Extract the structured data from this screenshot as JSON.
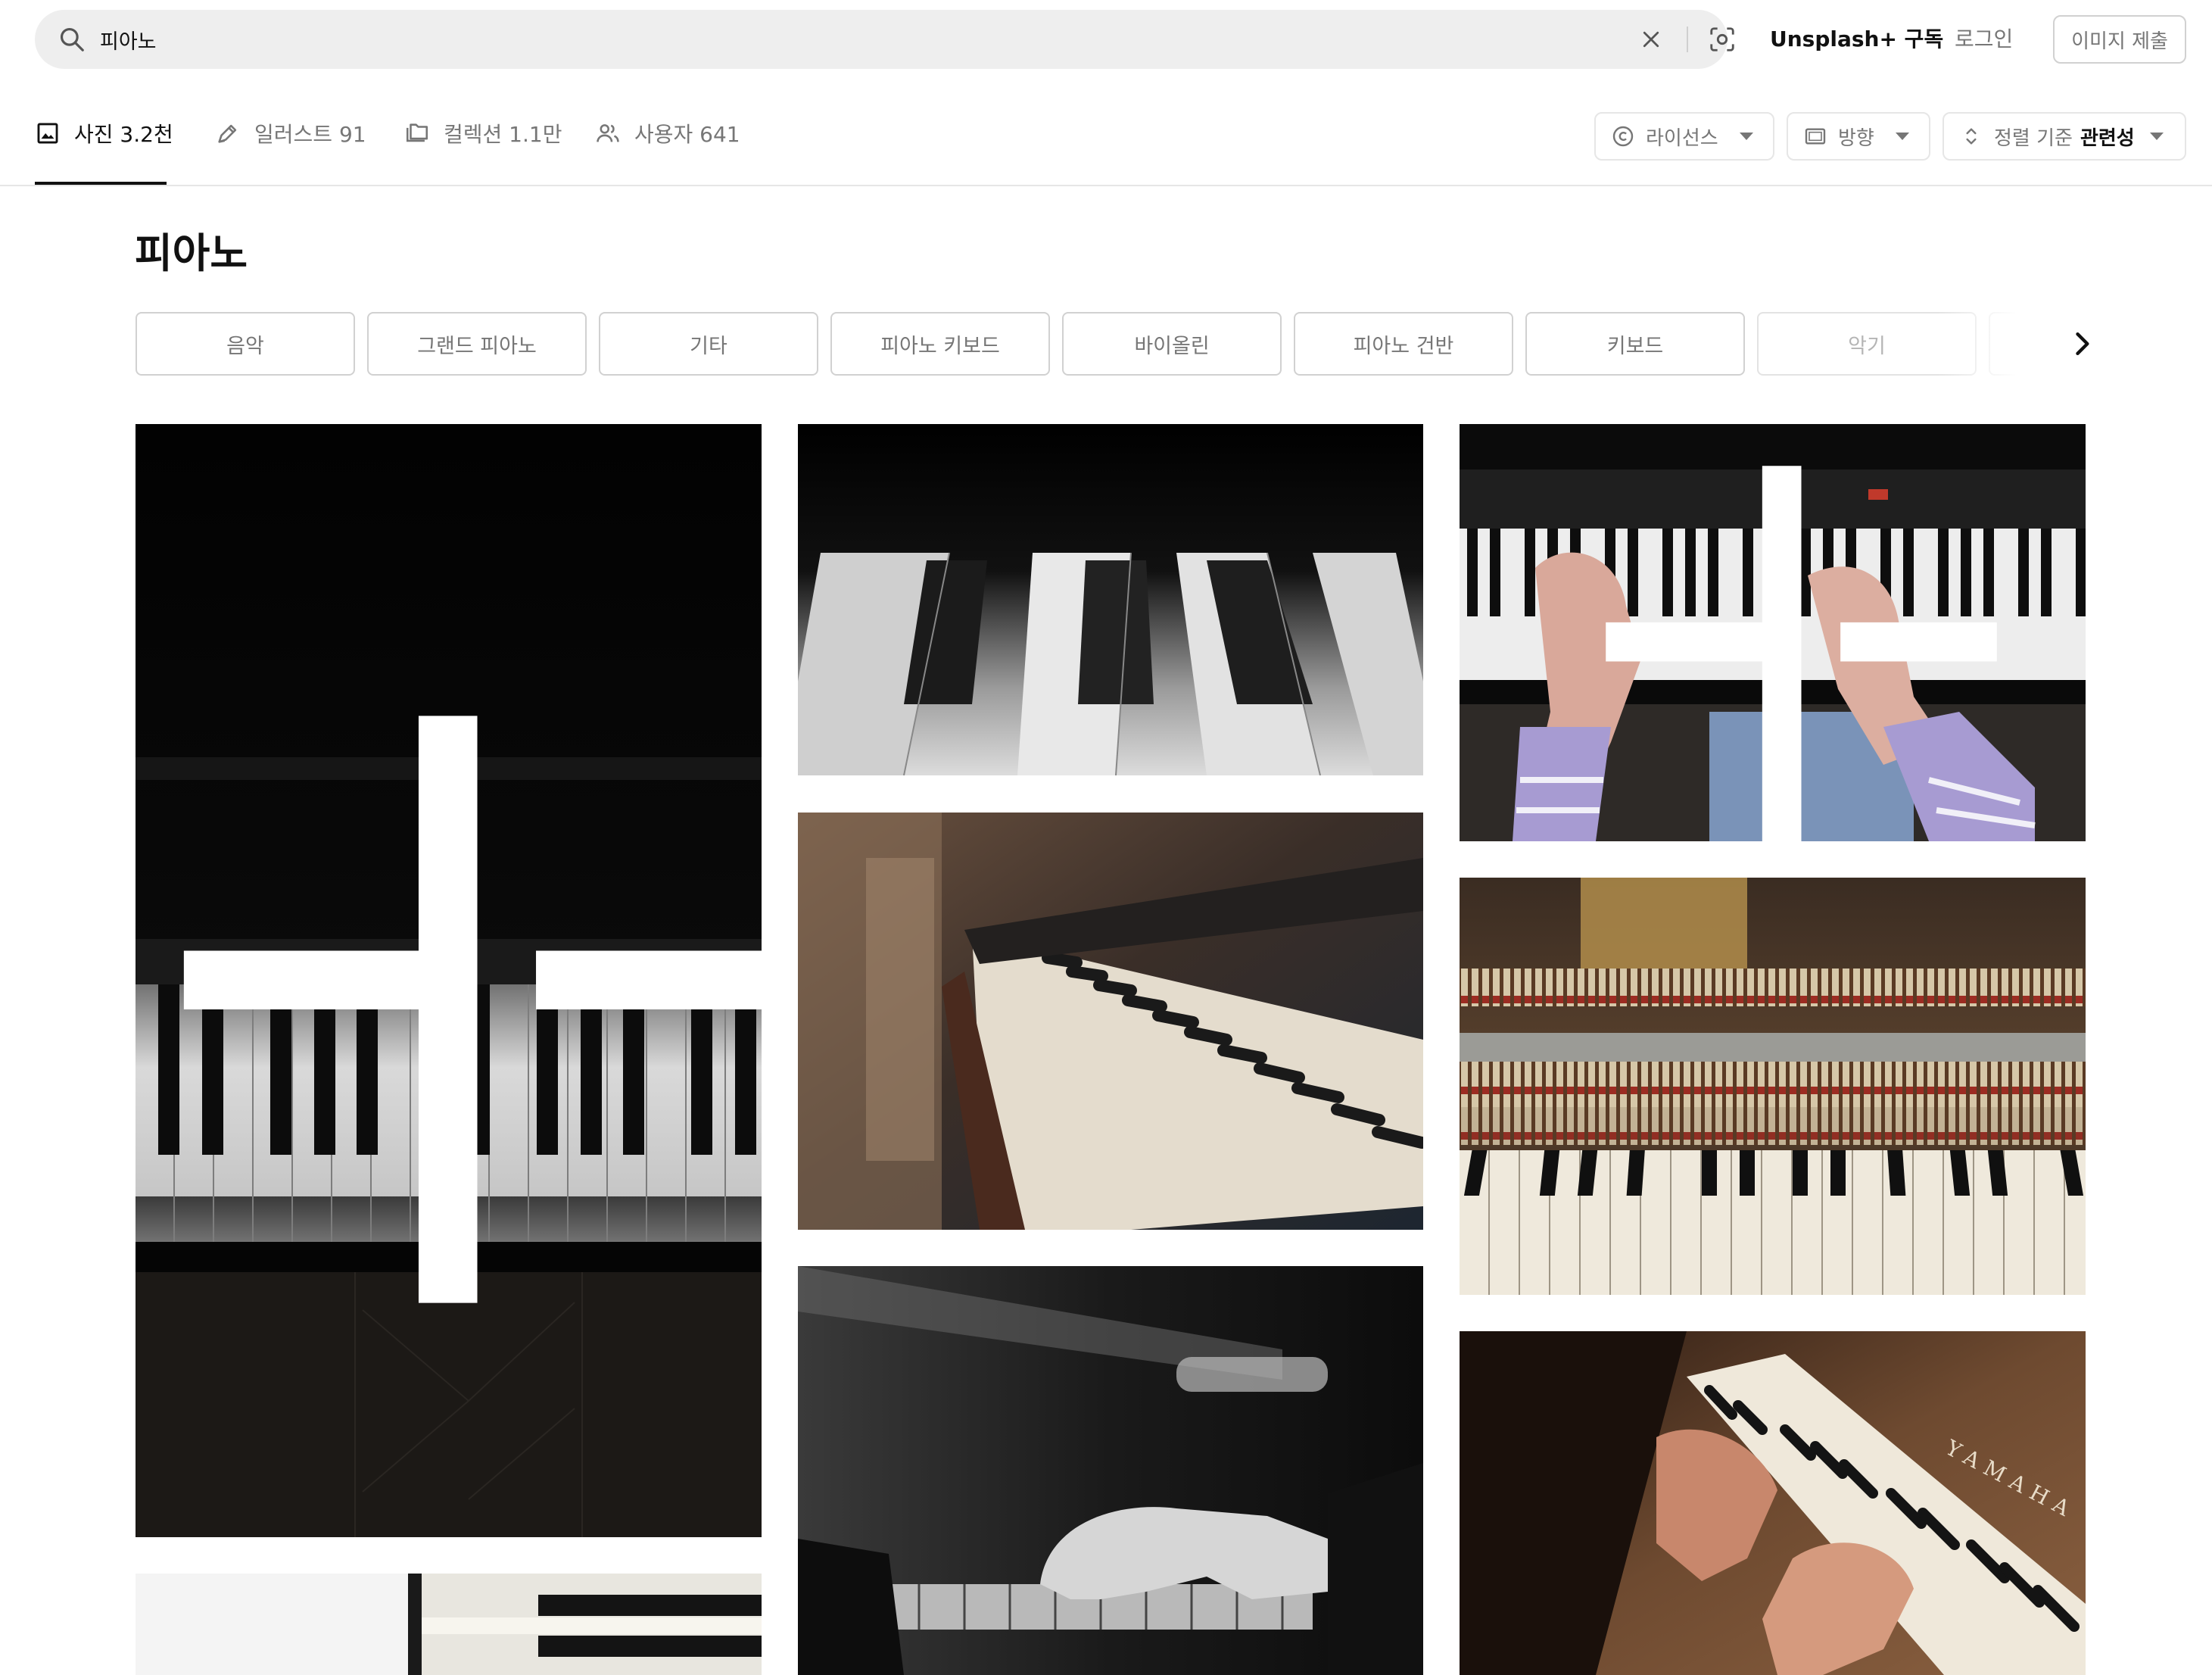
{
  "search": {
    "value": "피아노",
    "placeholder": ""
  },
  "header": {
    "unsplash_plus": "Unsplash+ 구독",
    "login": "로그인",
    "submit_image": "이미지 제출"
  },
  "tabs": [
    {
      "label": "사진 3.2천",
      "icon": "photo-icon"
    },
    {
      "label": "일러스트 91",
      "icon": "pen-icon"
    },
    {
      "label": "컬렉션 1.1만",
      "icon": "collection-icon"
    },
    {
      "label": "사용자 641",
      "icon": "users-icon"
    }
  ],
  "filters": {
    "license": "라이선스",
    "orientation": "방향",
    "sort_prefix": "정렬 기준",
    "sort_value": "관련성"
  },
  "page_title": "피아노",
  "related_chips": [
    "음악",
    "그랜드 피아노",
    "기타",
    "피아노 키보드",
    "바이올린",
    "피아노 건반",
    "키보드",
    "악기"
  ],
  "photos": {
    "col1": [
      "black piano keys on dark background (Unsplash+)",
      "white keyboard close-up"
    ],
    "col2": [
      "black and white piano keys close-up",
      "upright piano keys warm light",
      "pianist hands black and white"
    ],
    "col3": [
      "hands on digital piano (Unsplash+)",
      "inside of upright piano hammers",
      "hands playing Yamaha piano"
    ],
    "yamaha_text": "YAMAHA"
  },
  "colors": {
    "search_bg": "#eeeeee",
    "text_primary": "#111111",
    "text_secondary": "#767676",
    "border": "#d1d1d1"
  }
}
